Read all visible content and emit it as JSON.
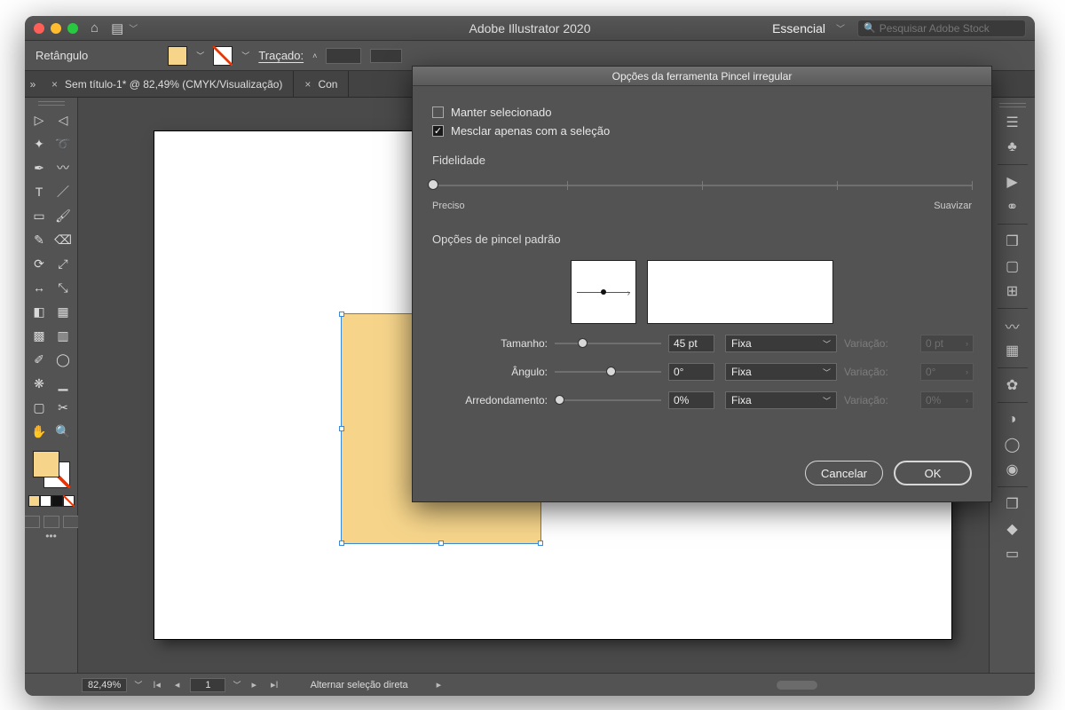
{
  "app": {
    "title": "Adobe Illustrator 2020"
  },
  "workspace": {
    "label": "Essencial"
  },
  "search": {
    "placeholder": "Pesquisar Adobe Stock"
  },
  "controlbar": {
    "tool": "Retângulo",
    "stroke_label": "Traçado:",
    "stroke_value": ""
  },
  "tabs": {
    "doc1": "Sem título-1* @ 82,49% (CMYK/Visualização)",
    "doc2_prefix": "Con"
  },
  "dialog": {
    "title": "Opções da ferramenta Pincel irregular",
    "keep_selected": "Manter selecionado",
    "merge_only": "Mesclar apenas com a seleção",
    "fidelity_label": "Fidelidade",
    "fidelity_min": "Preciso",
    "fidelity_max": "Suavizar",
    "brush_options": "Opções de pincel padrão",
    "size_label": "Tamanho:",
    "size_value": "45 pt",
    "angle_label": "Ângulo:",
    "angle_value": "0°",
    "round_label": "Arredondamento:",
    "round_value": "0%",
    "mode_option": "Fixa",
    "variation_label": "Variação:",
    "var_size_placeholder": "0 pt",
    "var_angle_placeholder": "0°",
    "var_round_placeholder": "0%",
    "cancel": "Cancelar",
    "ok": "OK"
  },
  "status": {
    "zoom": "82,49%",
    "page": "1",
    "hint": "Alternar seleção direta"
  }
}
